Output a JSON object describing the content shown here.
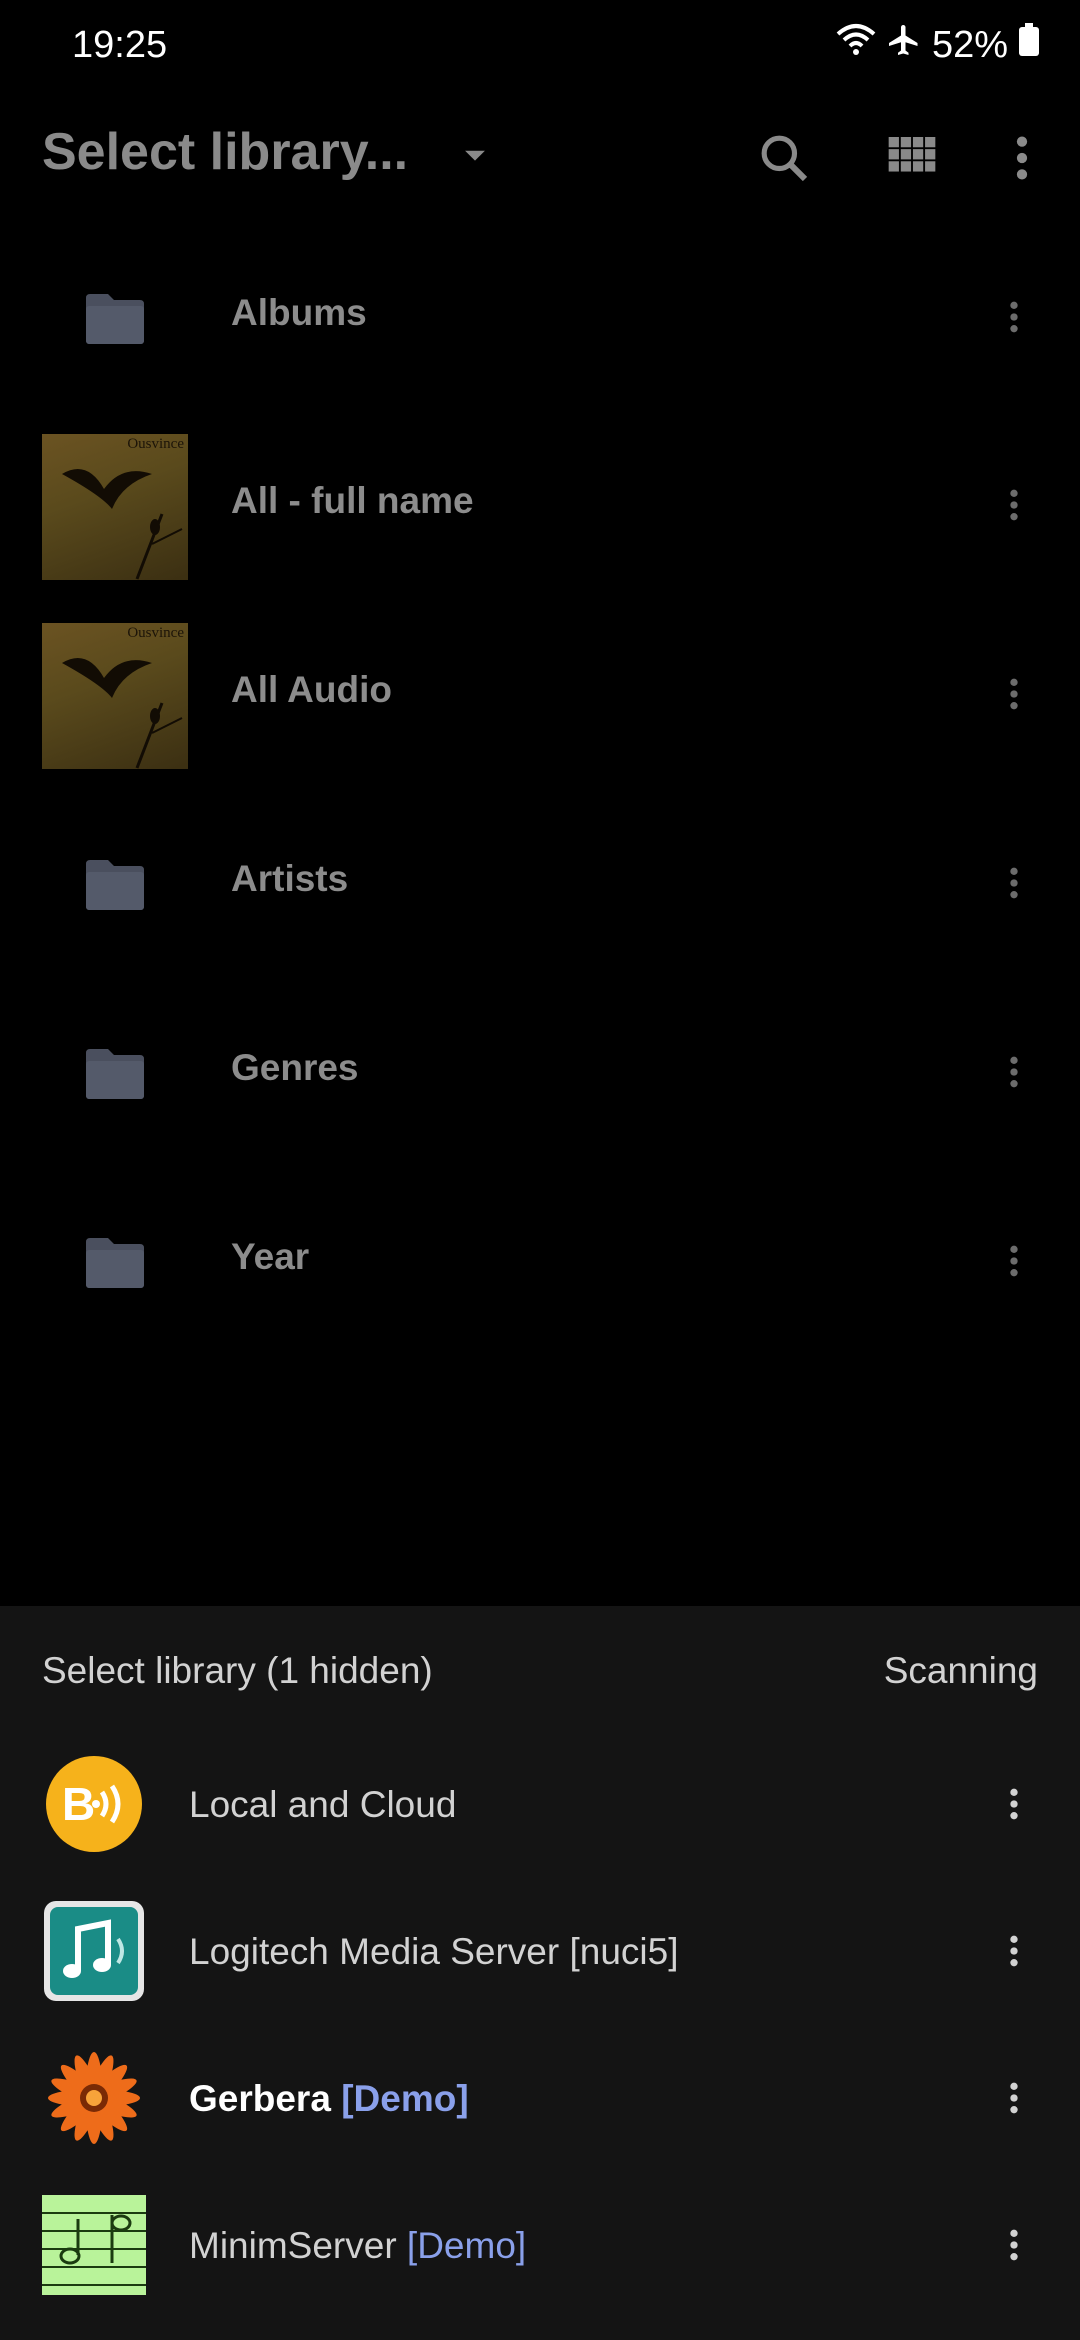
{
  "status": {
    "time": "19:25",
    "battery": "52%"
  },
  "appbar": {
    "title": "Select library..."
  },
  "library_items": [
    {
      "label": "Albums",
      "icon": "folder-icon"
    },
    {
      "label": "All - full name",
      "icon": "album-art",
      "art_title": "Ousvince"
    },
    {
      "label": "All Audio",
      "icon": "album-art",
      "art_title": "Ousvince"
    },
    {
      "label": "Artists",
      "icon": "folder-icon"
    },
    {
      "label": "Genres",
      "icon": "folder-icon"
    },
    {
      "label": "Year",
      "icon": "folder-icon"
    }
  ],
  "sheet": {
    "title": "Select library (1 hidden)",
    "status": "Scanning",
    "servers": [
      {
        "name": "Local and Cloud",
        "demo": "",
        "icon": "bubbleupnp-icon"
      },
      {
        "name": "Logitech Media Server [nuci5]",
        "demo": "",
        "icon": "music-note-icon"
      },
      {
        "name": "Gerbera",
        "demo": "[Demo]",
        "icon": "gerbera-flower-icon"
      },
      {
        "name": "MinimServer",
        "demo": "[Demo]",
        "icon": "sheet-music-icon"
      }
    ]
  },
  "colors": {
    "folder": "#4a4f5e",
    "accent_demo": "#8aa0ea",
    "sheet_bg": "#141414"
  }
}
